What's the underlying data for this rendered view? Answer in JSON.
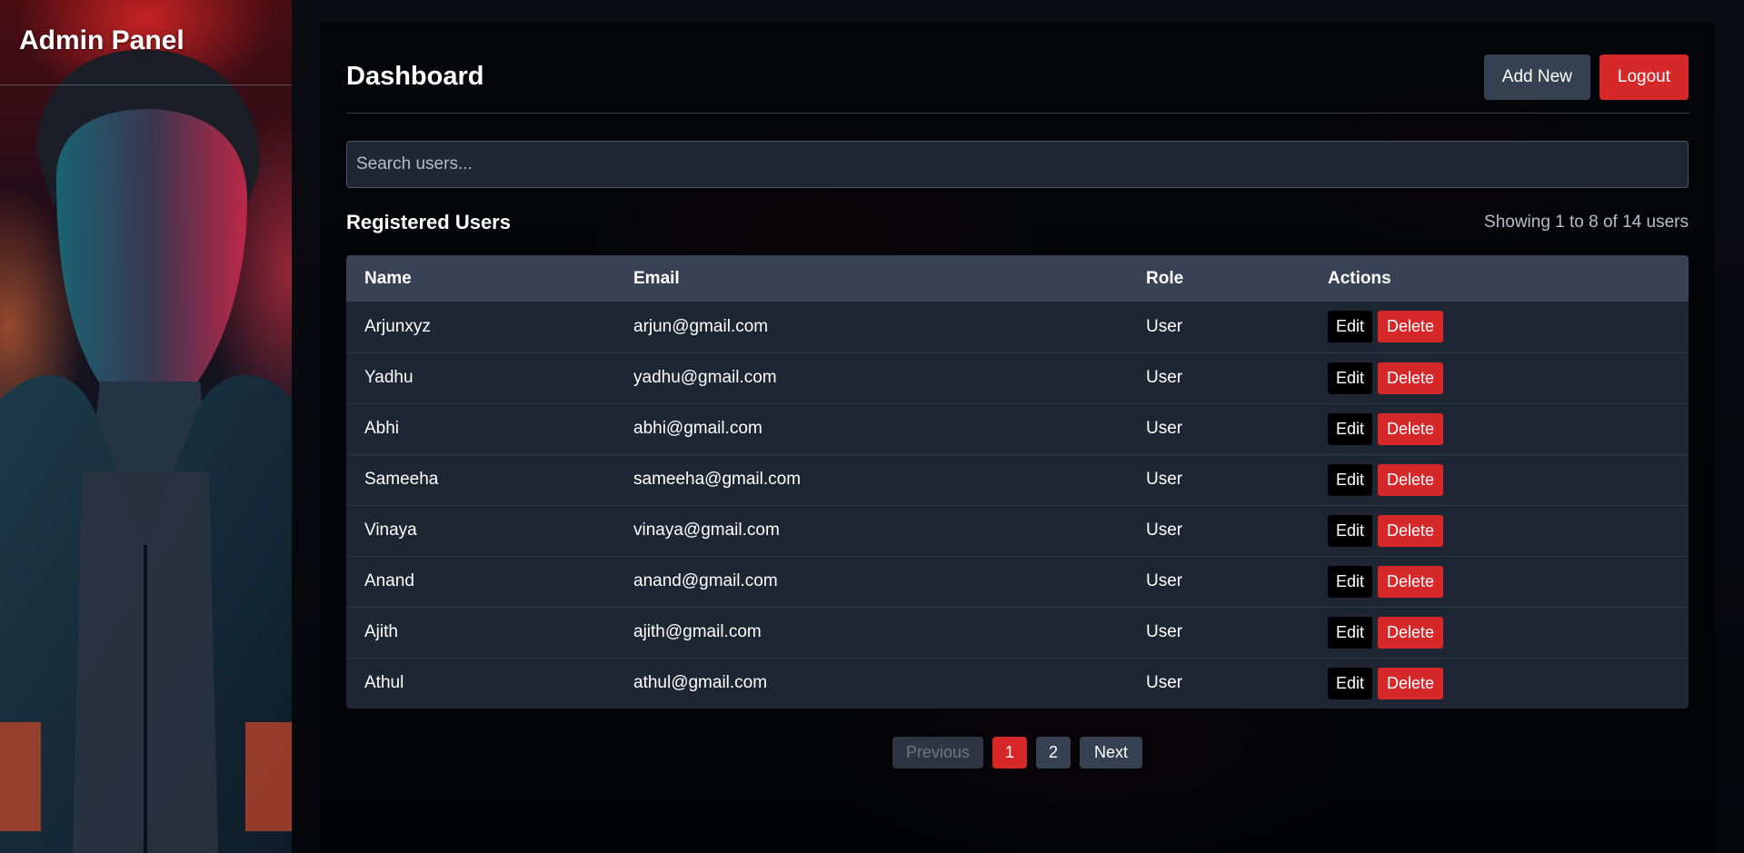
{
  "sidebar": {
    "title": "Admin Panel"
  },
  "header": {
    "title": "Dashboard",
    "add_new_label": "Add New",
    "logout_label": "Logout"
  },
  "search": {
    "placeholder": "Search users...",
    "value": ""
  },
  "users_section": {
    "title": "Registered Users",
    "showing_text": "Showing 1 to 8 of 14 users"
  },
  "table": {
    "columns": [
      "Name",
      "Email",
      "Role",
      "Actions"
    ],
    "edit_label": "Edit",
    "delete_label": "Delete",
    "rows": [
      {
        "name": "Arjunxyz",
        "email": "arjun@gmail.com",
        "role": "User"
      },
      {
        "name": "Yadhu",
        "email": "yadhu@gmail.com",
        "role": "User"
      },
      {
        "name": "Abhi",
        "email": "abhi@gmail.com",
        "role": "User"
      },
      {
        "name": "Sameeha",
        "email": "sameeha@gmail.com",
        "role": "User"
      },
      {
        "name": "Vinaya",
        "email": "vinaya@gmail.com",
        "role": "User"
      },
      {
        "name": "Anand",
        "email": "anand@gmail.com",
        "role": "User"
      },
      {
        "name": "Ajith",
        "email": "ajith@gmail.com",
        "role": "User"
      },
      {
        "name": "Athul",
        "email": "athul@gmail.com",
        "role": "User"
      }
    ]
  },
  "pagination": {
    "previous_label": "Previous",
    "pages": [
      "1",
      "2"
    ],
    "current_page": "1",
    "next_label": "Next"
  },
  "colors": {
    "accent_red": "#d62828",
    "button_slate": "#364152",
    "table_header": "#384254",
    "table_body": "#1f2633"
  }
}
